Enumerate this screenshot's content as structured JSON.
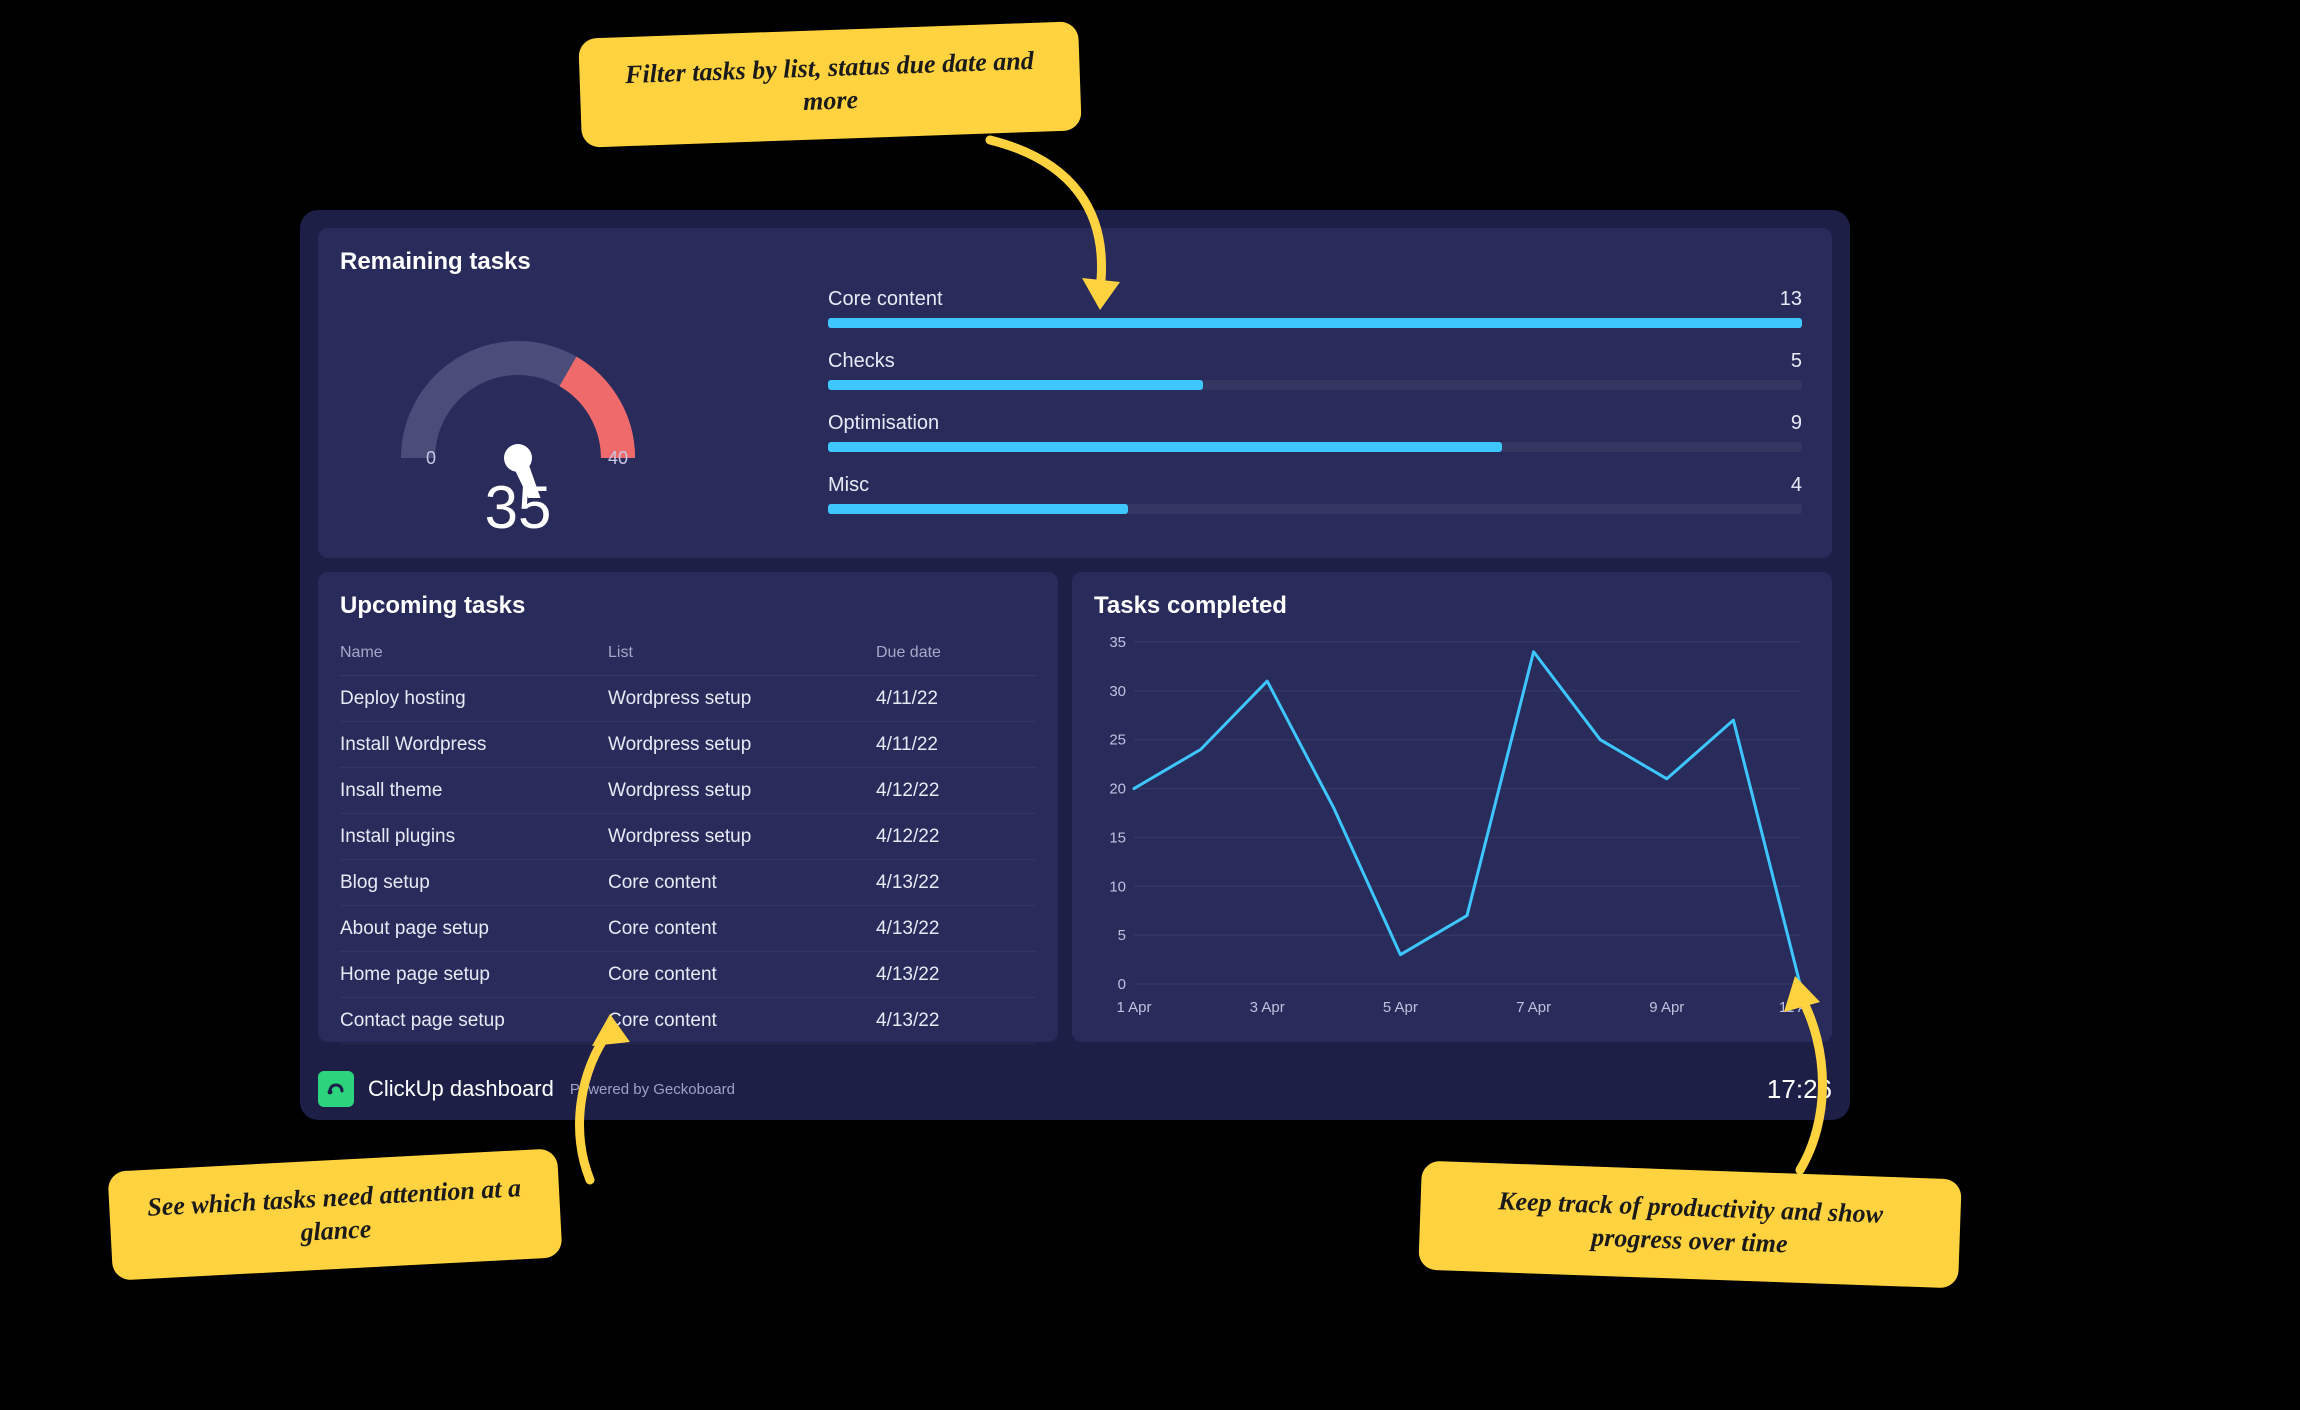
{
  "annotations": {
    "top": "Filter tasks by list, status due date and more",
    "left": "See which tasks need attention at a glance",
    "right": "Keep track of productivity and show progress over time"
  },
  "dashboard": {
    "name": "ClickUp dashboard",
    "powered": "Powered by Geckoboard",
    "clock": "17:26"
  },
  "remaining": {
    "title": "Remaining tasks",
    "gauge": {
      "min": "0",
      "max": "40",
      "value": "35"
    },
    "bars": [
      {
        "label": "Core content",
        "value": 13
      },
      {
        "label": "Checks",
        "value": 5
      },
      {
        "label": "Optimisation",
        "value": 9
      },
      {
        "label": "Misc",
        "value": 4
      }
    ],
    "bar_max": 13
  },
  "upcoming": {
    "title": "Upcoming tasks",
    "headers": {
      "name": "Name",
      "list": "List",
      "due": "Due date"
    },
    "rows": [
      {
        "name": "Deploy hosting",
        "list": "Wordpress setup",
        "due": "4/11/22"
      },
      {
        "name": "Install Wordpress",
        "list": "Wordpress setup",
        "due": "4/11/22"
      },
      {
        "name": "Insall theme",
        "list": "Wordpress setup",
        "due": "4/12/22"
      },
      {
        "name": "Install plugins",
        "list": "Wordpress setup",
        "due": "4/12/22"
      },
      {
        "name": "Blog setup",
        "list": "Core content",
        "due": "4/13/22"
      },
      {
        "name": "About page setup",
        "list": "Core content",
        "due": "4/13/22"
      },
      {
        "name": "Home page setup",
        "list": "Core content",
        "due": "4/13/22"
      },
      {
        "name": "Contact page setup",
        "list": "Core content",
        "due": "4/13/22"
      }
    ]
  },
  "completed": {
    "title": "Tasks completed"
  },
  "chart_data": {
    "type": "line",
    "title": "Tasks completed",
    "xlabel": "",
    "ylabel": "",
    "ylim": [
      0,
      35
    ],
    "y_ticks": [
      0,
      5,
      10,
      15,
      20,
      25,
      30,
      35
    ],
    "x_tick_labels": [
      "1 Apr",
      "3 Apr",
      "5 Apr",
      "7 Apr",
      "9 Apr",
      "11 Apr"
    ],
    "x_tick_positions": [
      1,
      3,
      5,
      7,
      9,
      11
    ],
    "x": [
      1,
      2,
      3,
      4,
      5,
      6,
      7,
      8,
      9,
      10,
      11
    ],
    "values": [
      20,
      24,
      31,
      18,
      3,
      7,
      34,
      25,
      21,
      27,
      0
    ],
    "line_color": "#3ec6ff"
  }
}
